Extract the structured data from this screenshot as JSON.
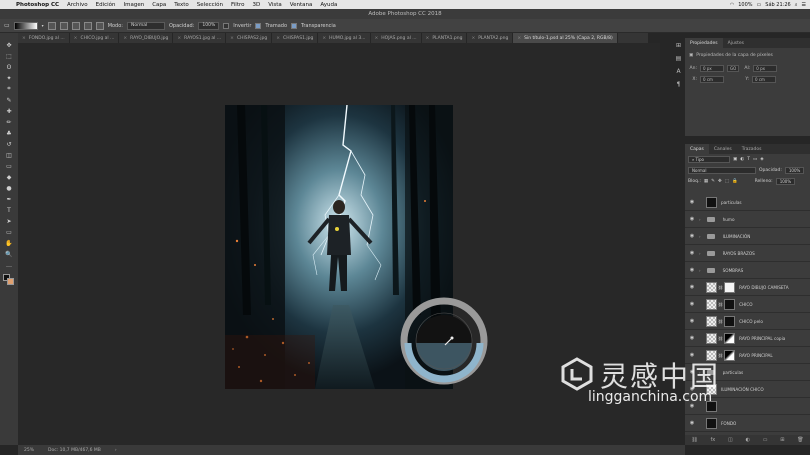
{
  "menubar": {
    "apple": "",
    "items": [
      "Photoshop CC",
      "Archivo",
      "Edición",
      "Imagen",
      "Capa",
      "Texto",
      "Selección",
      "Filtro",
      "3D",
      "Vista",
      "Ventana",
      "Ayuda"
    ],
    "clock": "Sáb 21:26",
    "battery": "100%"
  },
  "titlebar": {
    "title": "Adobe Photoshop CC 2018"
  },
  "options": {
    "mode_label": "Modo:",
    "mode_value": "Normal",
    "opacity_label": "Opacidad:",
    "opacity_value": "100%",
    "invert_label": "Invertir",
    "dither_label": "Tramado",
    "transparency_label": "Transparencia"
  },
  "tabs": [
    {
      "label": "FONDO.jpg al ..."
    },
    {
      "label": "CHICO.jpg al ..."
    },
    {
      "label": "RAYO_DIBUJO.jpg"
    },
    {
      "label": "RAYOS1.jpg al ..."
    },
    {
      "label": "CHISPAS2.jpg"
    },
    {
      "label": "CHISPAS1.jpg"
    },
    {
      "label": "HUMO.jpg al 3..."
    },
    {
      "label": "HOJAS.png al ..."
    },
    {
      "label": "PLANTA1.png"
    },
    {
      "label": "PLANTA2.png"
    },
    {
      "label": "Sin título-1.psd al 25% (Capa 2, RGB/8)"
    }
  ],
  "tools": [
    "move-icon",
    "marquee-icon",
    "lasso-icon",
    "magic-wand-icon",
    "crop-icon",
    "eyedropper-icon",
    "healing-icon",
    "brush-icon",
    "stamp-icon",
    "history-brush-icon",
    "eraser-icon",
    "gradient-icon",
    "blur-icon",
    "dodge-icon",
    "pen-icon",
    "type-icon",
    "path-select-icon",
    "shape-icon",
    "hand-icon",
    "zoom-icon",
    "more-icon"
  ],
  "tool_glyphs": [
    "✥",
    "⬚",
    "ʘ",
    "✦",
    "⌗",
    "✎",
    "✚",
    "✏",
    "♣",
    "↺",
    "◫",
    "▭",
    "◆",
    "●",
    "✒",
    "T",
    "➤",
    "▭",
    "✋",
    "🔍",
    "…"
  ],
  "properties": {
    "tabs": [
      "Propiedades",
      "Ajustes"
    ],
    "title": "Propiedades de la capa de píxeles",
    "w_label": "An:",
    "w_value": "0 px",
    "h_label": "Al:",
    "h_value": "0 px",
    "x_label": "X:",
    "x_value": "0 cm",
    "y_label": "Y:",
    "y_value": "0 cm",
    "link_label": "GO"
  },
  "layers": {
    "tabs": [
      "Capas",
      "Canales",
      "Trazados"
    ],
    "filter_label": "Tipo",
    "blend_mode": "Normal",
    "opacity_label": "Opacidad:",
    "opacity_value": "100%",
    "lock_label": "Bloq.:",
    "fill_label": "Relleno:",
    "fill_value": "100%",
    "items": [
      {
        "name": "particulas",
        "kind": "layer",
        "thumb": "dark"
      },
      {
        "name": "humo",
        "kind": "group"
      },
      {
        "name": "ILUMINACIÓN",
        "kind": "group"
      },
      {
        "name": "RAYOS BRAZOS",
        "kind": "group"
      },
      {
        "name": "SOMBRAS",
        "kind": "group"
      },
      {
        "name": "RAYO DIBUJO CAMISETA",
        "kind": "masked",
        "thumb": "check",
        "mask": "white"
      },
      {
        "name": "CHICO",
        "kind": "masked",
        "thumb": "check",
        "mask": "dark"
      },
      {
        "name": "CHICO pelo",
        "kind": "masked",
        "thumb": "check",
        "mask": "dark"
      },
      {
        "name": "RAYO PRINCIPAL copia",
        "kind": "masked",
        "thumb": "check",
        "mask": "mask"
      },
      {
        "name": "RAYO PRINCIPAL",
        "kind": "masked",
        "thumb": "check",
        "mask": "mask"
      },
      {
        "name": "particulas",
        "kind": "group"
      },
      {
        "name": "ILUMINACIÓN CHICO",
        "kind": "layer",
        "thumb": "check"
      },
      {
        "name": "",
        "kind": "layer",
        "thumb": "dark"
      },
      {
        "name": "FONDO",
        "kind": "layer",
        "thumb": "dark"
      }
    ]
  },
  "status": {
    "zoom": "25%",
    "doc": "Doc: 10,7 MB/467,6 MB"
  },
  "watermark": {
    "cn": "灵感中国",
    "en": "lingganchina.com"
  },
  "colors": {
    "accent": "#7a9cc6",
    "fg": "#111111",
    "bg": "#e0a070"
  }
}
